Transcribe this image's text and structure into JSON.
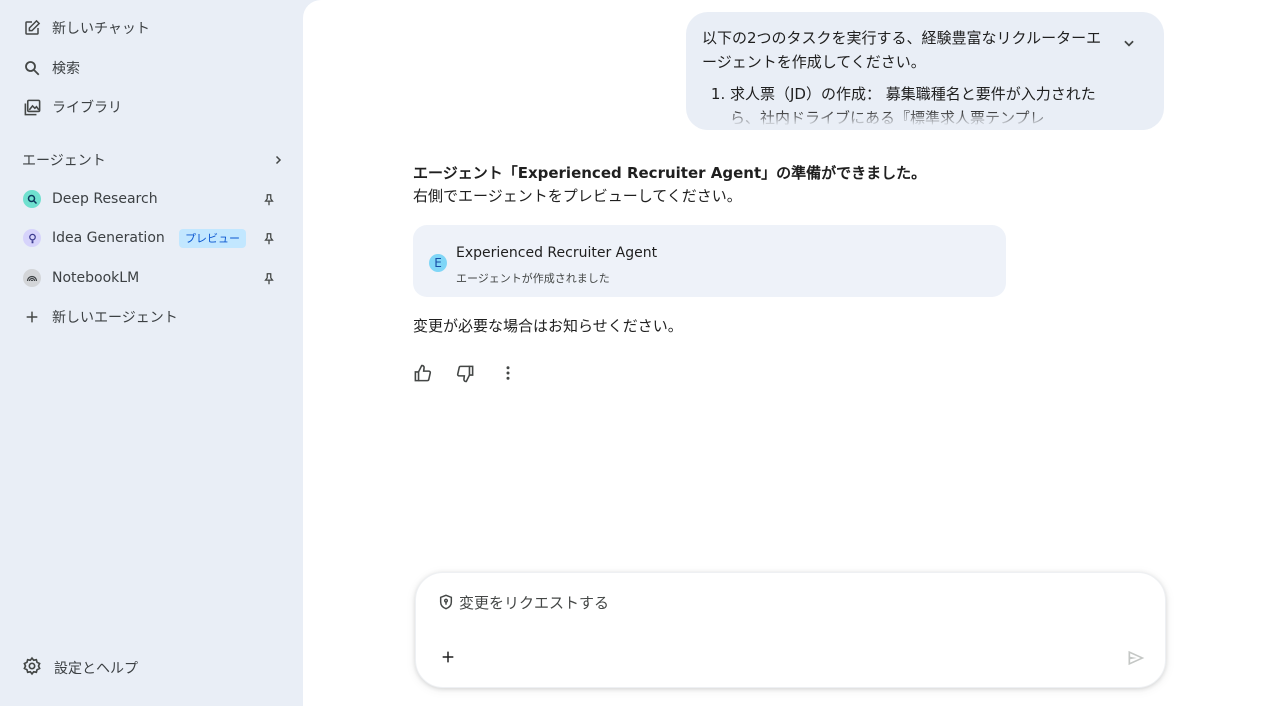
{
  "sidebar": {
    "new_chat": "新しいチャット",
    "search": "検索",
    "library": "ライブラリ",
    "agents_title": "エージェント",
    "agents": [
      {
        "name": "Deep Research",
        "badge": ""
      },
      {
        "name": "Idea Generation",
        "badge": "プレビュー"
      },
      {
        "name": "NotebookLM",
        "badge": ""
      }
    ],
    "new_agent": "新しいエージェント",
    "settings": "設定とヘルプ"
  },
  "user_message": {
    "text": "以下の2つのタスクを実行する、経験豊富なリクルーターエージェントを作成してください。",
    "item_1": "求人票（JD）の作成： 募集職種名と要件が入力されたら、社内ドライブにある『標準求人票テンプレ"
  },
  "response": {
    "title": "エージェント「Experienced Recruiter Agent」の準備ができました。",
    "subtitle": "右側でエージェントをプレビューしてください。",
    "card_avatar": "E",
    "card_name": "Experienced Recruiter Agent",
    "card_status": "エージェントが作成されました",
    "footer": "変更が必要な場合はお知らせください。"
  },
  "composer": {
    "placeholder": "変更をリクエストする"
  },
  "colors": {
    "sidebar_bg": "#e9eef6",
    "bubble_bg": "#e9eef6",
    "badge_bg": "#c2e7ff",
    "badge_text": "#0b57d0",
    "card_bg": "#eef2f9"
  },
  "icons": [
    "compose-icon",
    "search-icon",
    "library-icon",
    "chevron-right-icon",
    "deep-research-icon",
    "idea-icon",
    "notebooklm-icon",
    "pin-icon",
    "plus-icon",
    "gear-icon",
    "chevron-down-icon",
    "thumbs-up-icon",
    "thumbs-down-icon",
    "more-vert-icon",
    "shield-icon",
    "send-icon"
  ]
}
